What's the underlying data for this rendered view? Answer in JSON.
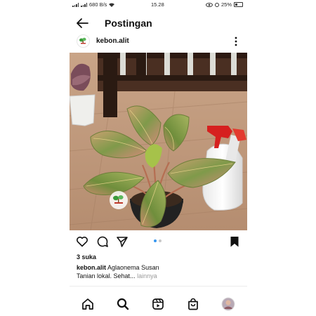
{
  "status_bar": {
    "network_speed": "680 B/s",
    "time": "15.28",
    "battery": "25%"
  },
  "header": {
    "title": "Postingan"
  },
  "post": {
    "username": "kebon.alit",
    "likes": "3 suka",
    "caption_user": "kebon.alit",
    "caption_text": "Aglaonema Susan",
    "caption_line2": "Tanian lokal. Sehat...",
    "more_label": "lainnya",
    "carousel_count": 2,
    "carousel_active": 1
  },
  "colors": {
    "accent": "#3897f0",
    "text": "#111111",
    "muted": "#999999"
  },
  "icons": {
    "back": "arrow-left-icon",
    "more": "more-vertical-icon",
    "like": "heart-icon",
    "comment": "comment-icon",
    "share": "send-icon",
    "save": "bookmark-icon",
    "home": "home-icon",
    "search": "search-icon",
    "reels": "reels-icon",
    "shop": "shop-icon"
  }
}
